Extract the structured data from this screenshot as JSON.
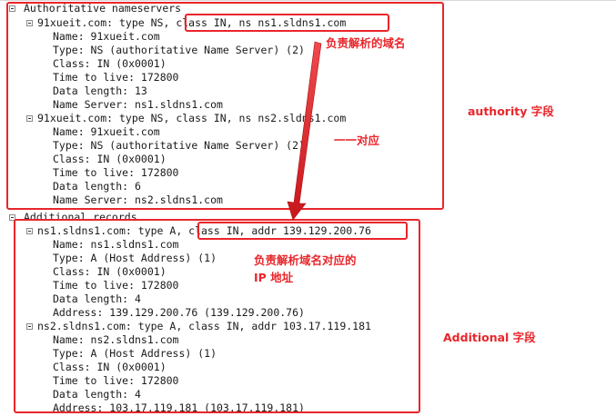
{
  "packet": {
    "authority": {
      "header": "Authoritative nameservers",
      "records": [
        {
          "summary": "91xueit.com: type NS, class IN, ns ns1.sldns1.com",
          "name": "Name: 91xueit.com",
          "type": "Type: NS (authoritative Name Server) (2)",
          "class": "Class: IN (0x0001)",
          "ttl": "Time to live: 172800",
          "length": "Data length: 13",
          "value": "Name Server: ns1.sldns1.com"
        },
        {
          "summary": "91xueit.com: type NS, class IN, ns ns2.sldns1.com",
          "name": "Name: 91xueit.com",
          "type": "Type: NS (authoritative Name Server) (2)",
          "class": "Class: IN (0x0001)",
          "ttl": "Time to live: 172800",
          "length": "Data length: 6",
          "value": "Name Server: ns2.sldns1.com"
        }
      ]
    },
    "additional": {
      "header": "Additional records",
      "records": [
        {
          "summary": "ns1.sldns1.com: type A, class IN, addr 139.129.200.76",
          "name": "Name: ns1.sldns1.com",
          "type": "Type: A (Host Address) (1)",
          "class": "Class: IN (0x0001)",
          "ttl": "Time to live: 172800",
          "length": "Data length: 4",
          "value": "Address: 139.129.200.76 (139.129.200.76)"
        },
        {
          "summary": "ns2.sldns1.com: type A, class IN, addr 103.17.119.181",
          "name": "Name: ns2.sldns1.com",
          "type": "Type: A (Host Address) (1)",
          "class": "Class: IN (0x0001)",
          "ttl": "Time to live: 172800",
          "length": "Data length: 4",
          "value": "Address: 103.17.119.181 (103.17.119.181)"
        }
      ]
    }
  },
  "annotations": {
    "responsible_domain": "负责解析的域名",
    "one_to_one": "一一对应",
    "authority_field": "authority 字段",
    "responsible_ip_line1": "负责解析域名对应的",
    "responsible_ip_line2": "IP 地址",
    "additional_field": "Additional 字段"
  },
  "colors": {
    "annotation_red": "#e8262b",
    "text": "#1a1a1a"
  },
  "icons": {
    "tree_toggle": "collapse-minus-icon",
    "pointer": "arrow-down-icon"
  }
}
